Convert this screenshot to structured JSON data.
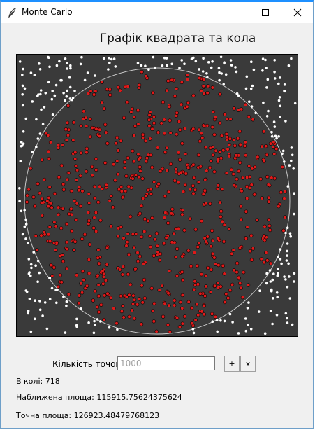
{
  "window": {
    "title": "Monte Carlo",
    "controls": [
      "minimize-icon",
      "maximize-icon",
      "close-icon"
    ]
  },
  "chart_data": {
    "type": "scatter",
    "title": "Графік квадрата та кола",
    "total_points": 1000,
    "inside_count": 718,
    "xlim": [
      0,
      1
    ],
    "ylim": [
      0,
      1
    ],
    "shapes": [
      "square",
      "circle"
    ],
    "series": [
      {
        "label": "inside",
        "color": "#e01a1a"
      },
      {
        "label": "outside",
        "color": "#ffffff"
      }
    ],
    "background": "#3a3a3a",
    "circle_color": "#c8c8c8"
  },
  "controls": {
    "count_label": "Кількість точок:",
    "count_value": "1000",
    "plus_label": "+",
    "clear_label": "x"
  },
  "results": {
    "inside_text": "В колі: 718",
    "approx_text": "Наближена площа: 115915.75624375624",
    "exact_text": "Точна площа: 126923.48479768123"
  }
}
